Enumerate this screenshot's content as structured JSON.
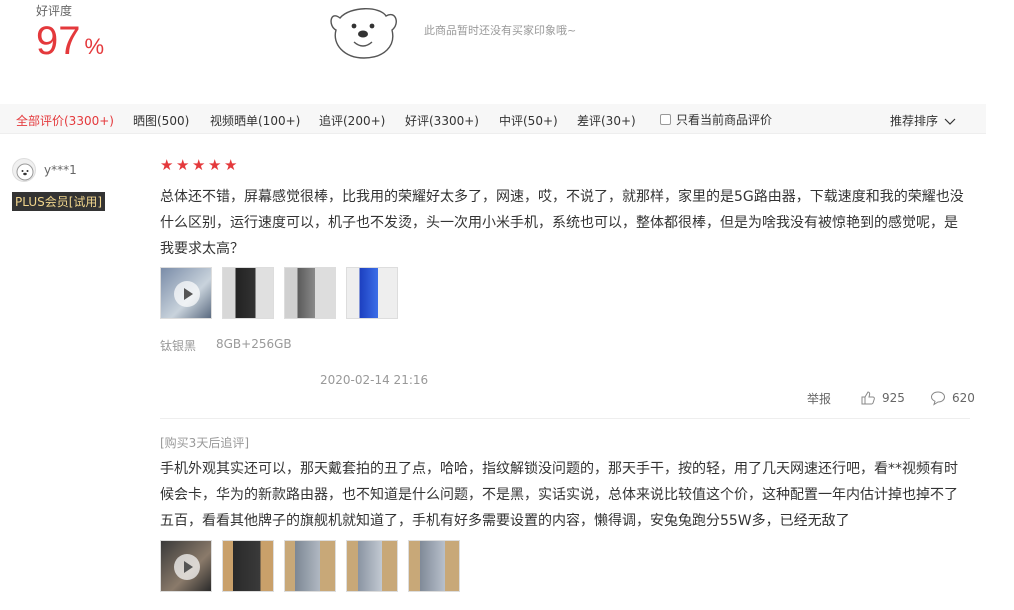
{
  "summary": {
    "rate_label": "好评度",
    "rate_value": "97",
    "rate_unit": "%",
    "no_impression_text": "此商品暂时还没有买家印象哦~"
  },
  "filter": {
    "tabs": [
      {
        "label": "全部评价(3300+)",
        "active": true
      },
      {
        "label": "晒图(500)"
      },
      {
        "label": "视频晒单(100+)"
      },
      {
        "label": "追评(200+)"
      },
      {
        "label": "好评(3300+)"
      },
      {
        "label": "中评(50+)"
      },
      {
        "label": "差评(30+)"
      }
    ],
    "only_current_label": "只看当前商品评价",
    "sort_label": "推荐排序"
  },
  "review": {
    "user": {
      "name": "y***1",
      "badge": "PLUS会员[试用]"
    },
    "rating": 5,
    "text": "总体还不错，屏幕感觉很棒，比我用的荣耀好太多了，网速，哎，不说了，就那样，家里的是5G路由器，下载速度和我的荣耀也没什么区别，运行速度可以，机子也不发烫，头一次用小米手机，系统也可以，整体都很棒，但是为啥我没有被惊艳到的感觉呢，是我要求太高？",
    "color": "钛银黑",
    "config": "8GB+256GB",
    "date": "2020-02-14 21:16",
    "report_label": "举报",
    "likes": "925",
    "comments": "620",
    "followup": {
      "label": "[购买3天后追评]",
      "text": "手机外观其实还可以，那天戴套拍的丑了点，哈哈，指纹解锁没问题的，那天手干，按的轻，用了几天网速还行吧，看**视频有时候会卡，华为的新款路由器，也不知道是什么问题，不是黑，实话实说，总体来说比较值这个价，这种配置一年内估计掉也掉不了五百，看看其他牌子的旗舰机就知道了，手机有好多需要设置的内容，懒得调，安兔兔跑分55W多，已经无敌了"
    }
  },
  "colors": {
    "accent": "#e4393c",
    "muted": "#999999"
  }
}
